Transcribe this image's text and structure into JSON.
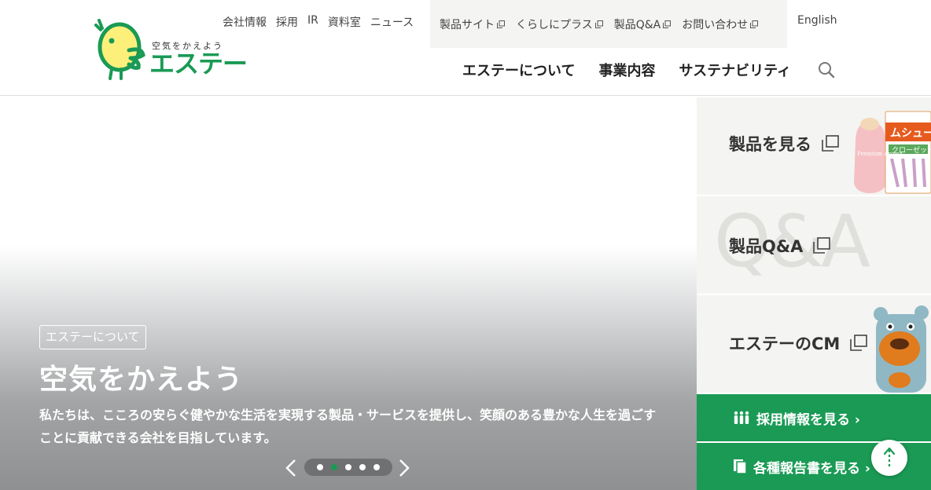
{
  "logo": {
    "sub": "空気をかえよう",
    "main": "エステー"
  },
  "utility_nav": [
    "会社情報",
    "採用",
    "IR",
    "資料室",
    "ニュース"
  ],
  "external_nav": [
    "製品サイト",
    "くらしにプラス",
    "製品Q&A",
    "お問い合わせ"
  ],
  "language": "English",
  "main_nav": [
    "エステーについて",
    "事業内容",
    "サステナビリティ"
  ],
  "hero": {
    "badge": "エステーについて",
    "title": "空気をかえよう",
    "text": "私たちは、こころの安らぐ健やかな生活を実現する製品・サービスを提供し、笑顔のある豊かな人生を過ごすことに貢献できる会社を目指しています。",
    "slide_count": 5,
    "active_slide": 2
  },
  "side_cards": {
    "products": "製品を見る",
    "qa": "製品Q&A",
    "qa_bg": "Q&A",
    "cm": "エステーのCM"
  },
  "product_pack": {
    "brand": "ムシューダ",
    "tag": "クローゼット",
    "aroma": "Premium Aroma"
  },
  "buttons": {
    "recruit": "採用情報を見る ›",
    "reports": "各種報告書を見る ›"
  },
  "colors": {
    "brand_green": "#1a9a55",
    "logo_yellow": "#fdf07a",
    "panel_gray": "#f4f4f2"
  }
}
